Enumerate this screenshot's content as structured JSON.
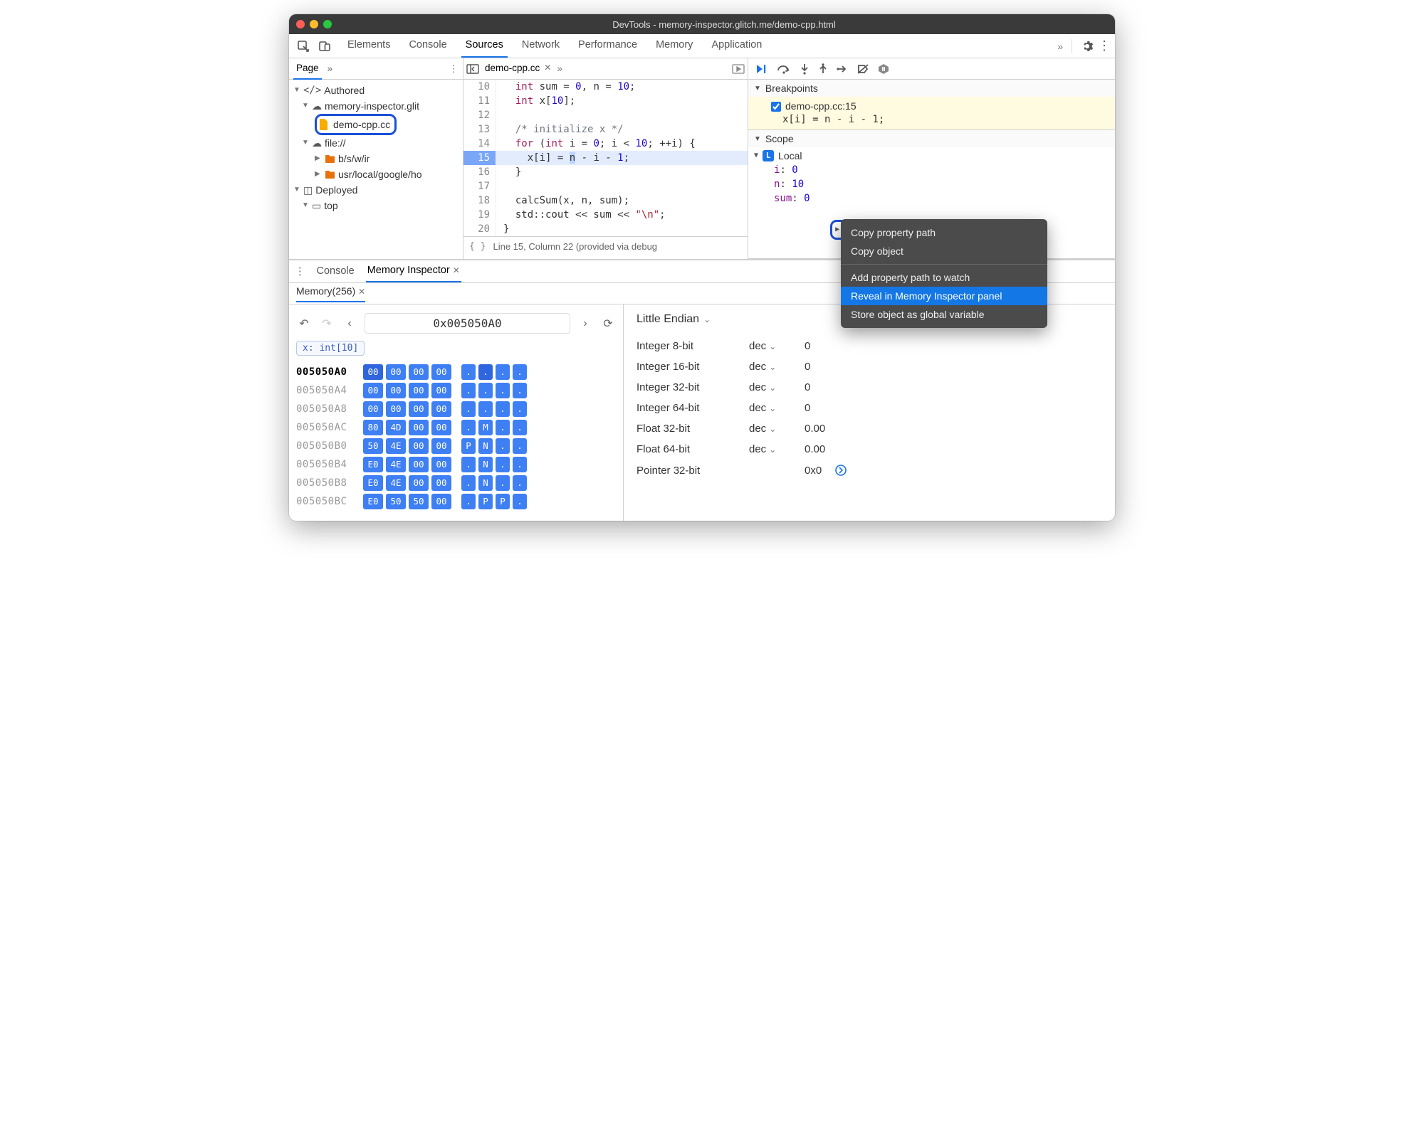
{
  "window": {
    "title": "DevTools - memory-inspector.glitch.me/demo-cpp.html"
  },
  "topTabs": {
    "items": [
      "Elements",
      "Console",
      "Sources",
      "Network",
      "Performance",
      "Memory",
      "Application"
    ],
    "active": "Sources"
  },
  "navigator": {
    "tab": "Page",
    "tree": {
      "authored": "Authored",
      "domain": "memory-inspector.glit",
      "file": "demo-cpp.cc",
      "fileNode": "file://",
      "folder1": "b/s/w/ir",
      "folder2": "usr/local/google/ho",
      "deployed": "Deployed",
      "top": "top"
    }
  },
  "editor": {
    "tab": "demo-cpp.cc",
    "lines": [
      {
        "n": 10,
        "html": "  <span class='tok-type'>int</span> sum = <span class='tok-num'>0</span>, n = <span class='tok-num'>10</span>;"
      },
      {
        "n": 11,
        "html": "  <span class='tok-type'>int</span> x[<span class='tok-num'>10</span>];"
      },
      {
        "n": 12,
        "html": ""
      },
      {
        "n": 13,
        "html": "  <span class='tok-cmt'>/* initialize x */</span>"
      },
      {
        "n": 14,
        "html": "  <span class='tok-kw'>for</span> (<span class='tok-type'>int</span> i = <span class='tok-num'>0</span>; i &lt; <span class='tok-num'>10</span>; ++i) {"
      },
      {
        "n": 15,
        "html": "    x[i] = <span class='sel'>n</span> - i - <span class='tok-num'>1</span>;",
        "hl": true
      },
      {
        "n": 16,
        "html": "  }"
      },
      {
        "n": 17,
        "html": ""
      },
      {
        "n": 18,
        "html": "  calcSum(x, n, sum);"
      },
      {
        "n": 19,
        "html": "  std::cout &lt;&lt; sum &lt;&lt; <span class='tok-str'>\"\\n\"</span>;"
      },
      {
        "n": 20,
        "html": "}"
      }
    ],
    "status": "Line 15, Column 22  (provided via debug"
  },
  "debugger": {
    "breakpoints": {
      "title": "Breakpoints",
      "name": "demo-cpp.cc:15",
      "code": "x[i] = n - i - 1;"
    },
    "scope": {
      "title": "Scope",
      "local": "Local",
      "vars": {
        "i": "0",
        "n": "10",
        "sum": "0",
        "xLabel": "x",
        "xType": "int[10]"
      }
    }
  },
  "contextMenu": {
    "items": [
      "Copy property path",
      "Copy object",
      "Add property path to watch",
      "Reveal in Memory Inspector panel",
      "Store object as global variable"
    ],
    "highlightIndex": 3
  },
  "drawer": {
    "tabs": {
      "console": "Console",
      "mi": "Memory Inspector"
    },
    "memTab": "Memory(256)",
    "address": "0x005050A0",
    "chip": "x: int[10]",
    "rows": [
      {
        "addr": "005050A0",
        "bytes": [
          "00",
          "00",
          "00",
          "00"
        ],
        "asc": [
          ".",
          ".",
          ".",
          "."
        ],
        "first": true
      },
      {
        "addr": "005050A4",
        "bytes": [
          "00",
          "00",
          "00",
          "00"
        ],
        "asc": [
          ".",
          ".",
          ".",
          "."
        ]
      },
      {
        "addr": "005050A8",
        "bytes": [
          "00",
          "00",
          "00",
          "00"
        ],
        "asc": [
          ".",
          ".",
          ".",
          "."
        ]
      },
      {
        "addr": "005050AC",
        "bytes": [
          "80",
          "4D",
          "00",
          "00"
        ],
        "asc": [
          ".",
          "M",
          ".",
          "."
        ]
      },
      {
        "addr": "005050B0",
        "bytes": [
          "50",
          "4E",
          "00",
          "00"
        ],
        "asc": [
          "P",
          "N",
          ".",
          "."
        ]
      },
      {
        "addr": "005050B4",
        "bytes": [
          "E0",
          "4E",
          "00",
          "00"
        ],
        "asc": [
          ".",
          "N",
          ".",
          "."
        ]
      },
      {
        "addr": "005050B8",
        "bytes": [
          "E0",
          "4E",
          "00",
          "00"
        ],
        "asc": [
          ".",
          "N",
          ".",
          "."
        ]
      },
      {
        "addr": "005050BC",
        "bytes": [
          "E0",
          "50",
          "50",
          "00"
        ],
        "asc": [
          ".",
          "P",
          "P",
          "."
        ]
      }
    ],
    "endian": "Little Endian",
    "values": [
      {
        "label": "Integer 8-bit",
        "fmt": "dec",
        "val": "0"
      },
      {
        "label": "Integer 16-bit",
        "fmt": "dec",
        "val": "0"
      },
      {
        "label": "Integer 32-bit",
        "fmt": "dec",
        "val": "0"
      },
      {
        "label": "Integer 64-bit",
        "fmt": "dec",
        "val": "0"
      },
      {
        "label": "Float 32-bit",
        "fmt": "dec",
        "val": "0.00"
      },
      {
        "label": "Float 64-bit",
        "fmt": "dec",
        "val": "0.00"
      },
      {
        "label": "Pointer 32-bit",
        "fmt": "",
        "val": "0x0",
        "link": true
      }
    ]
  }
}
